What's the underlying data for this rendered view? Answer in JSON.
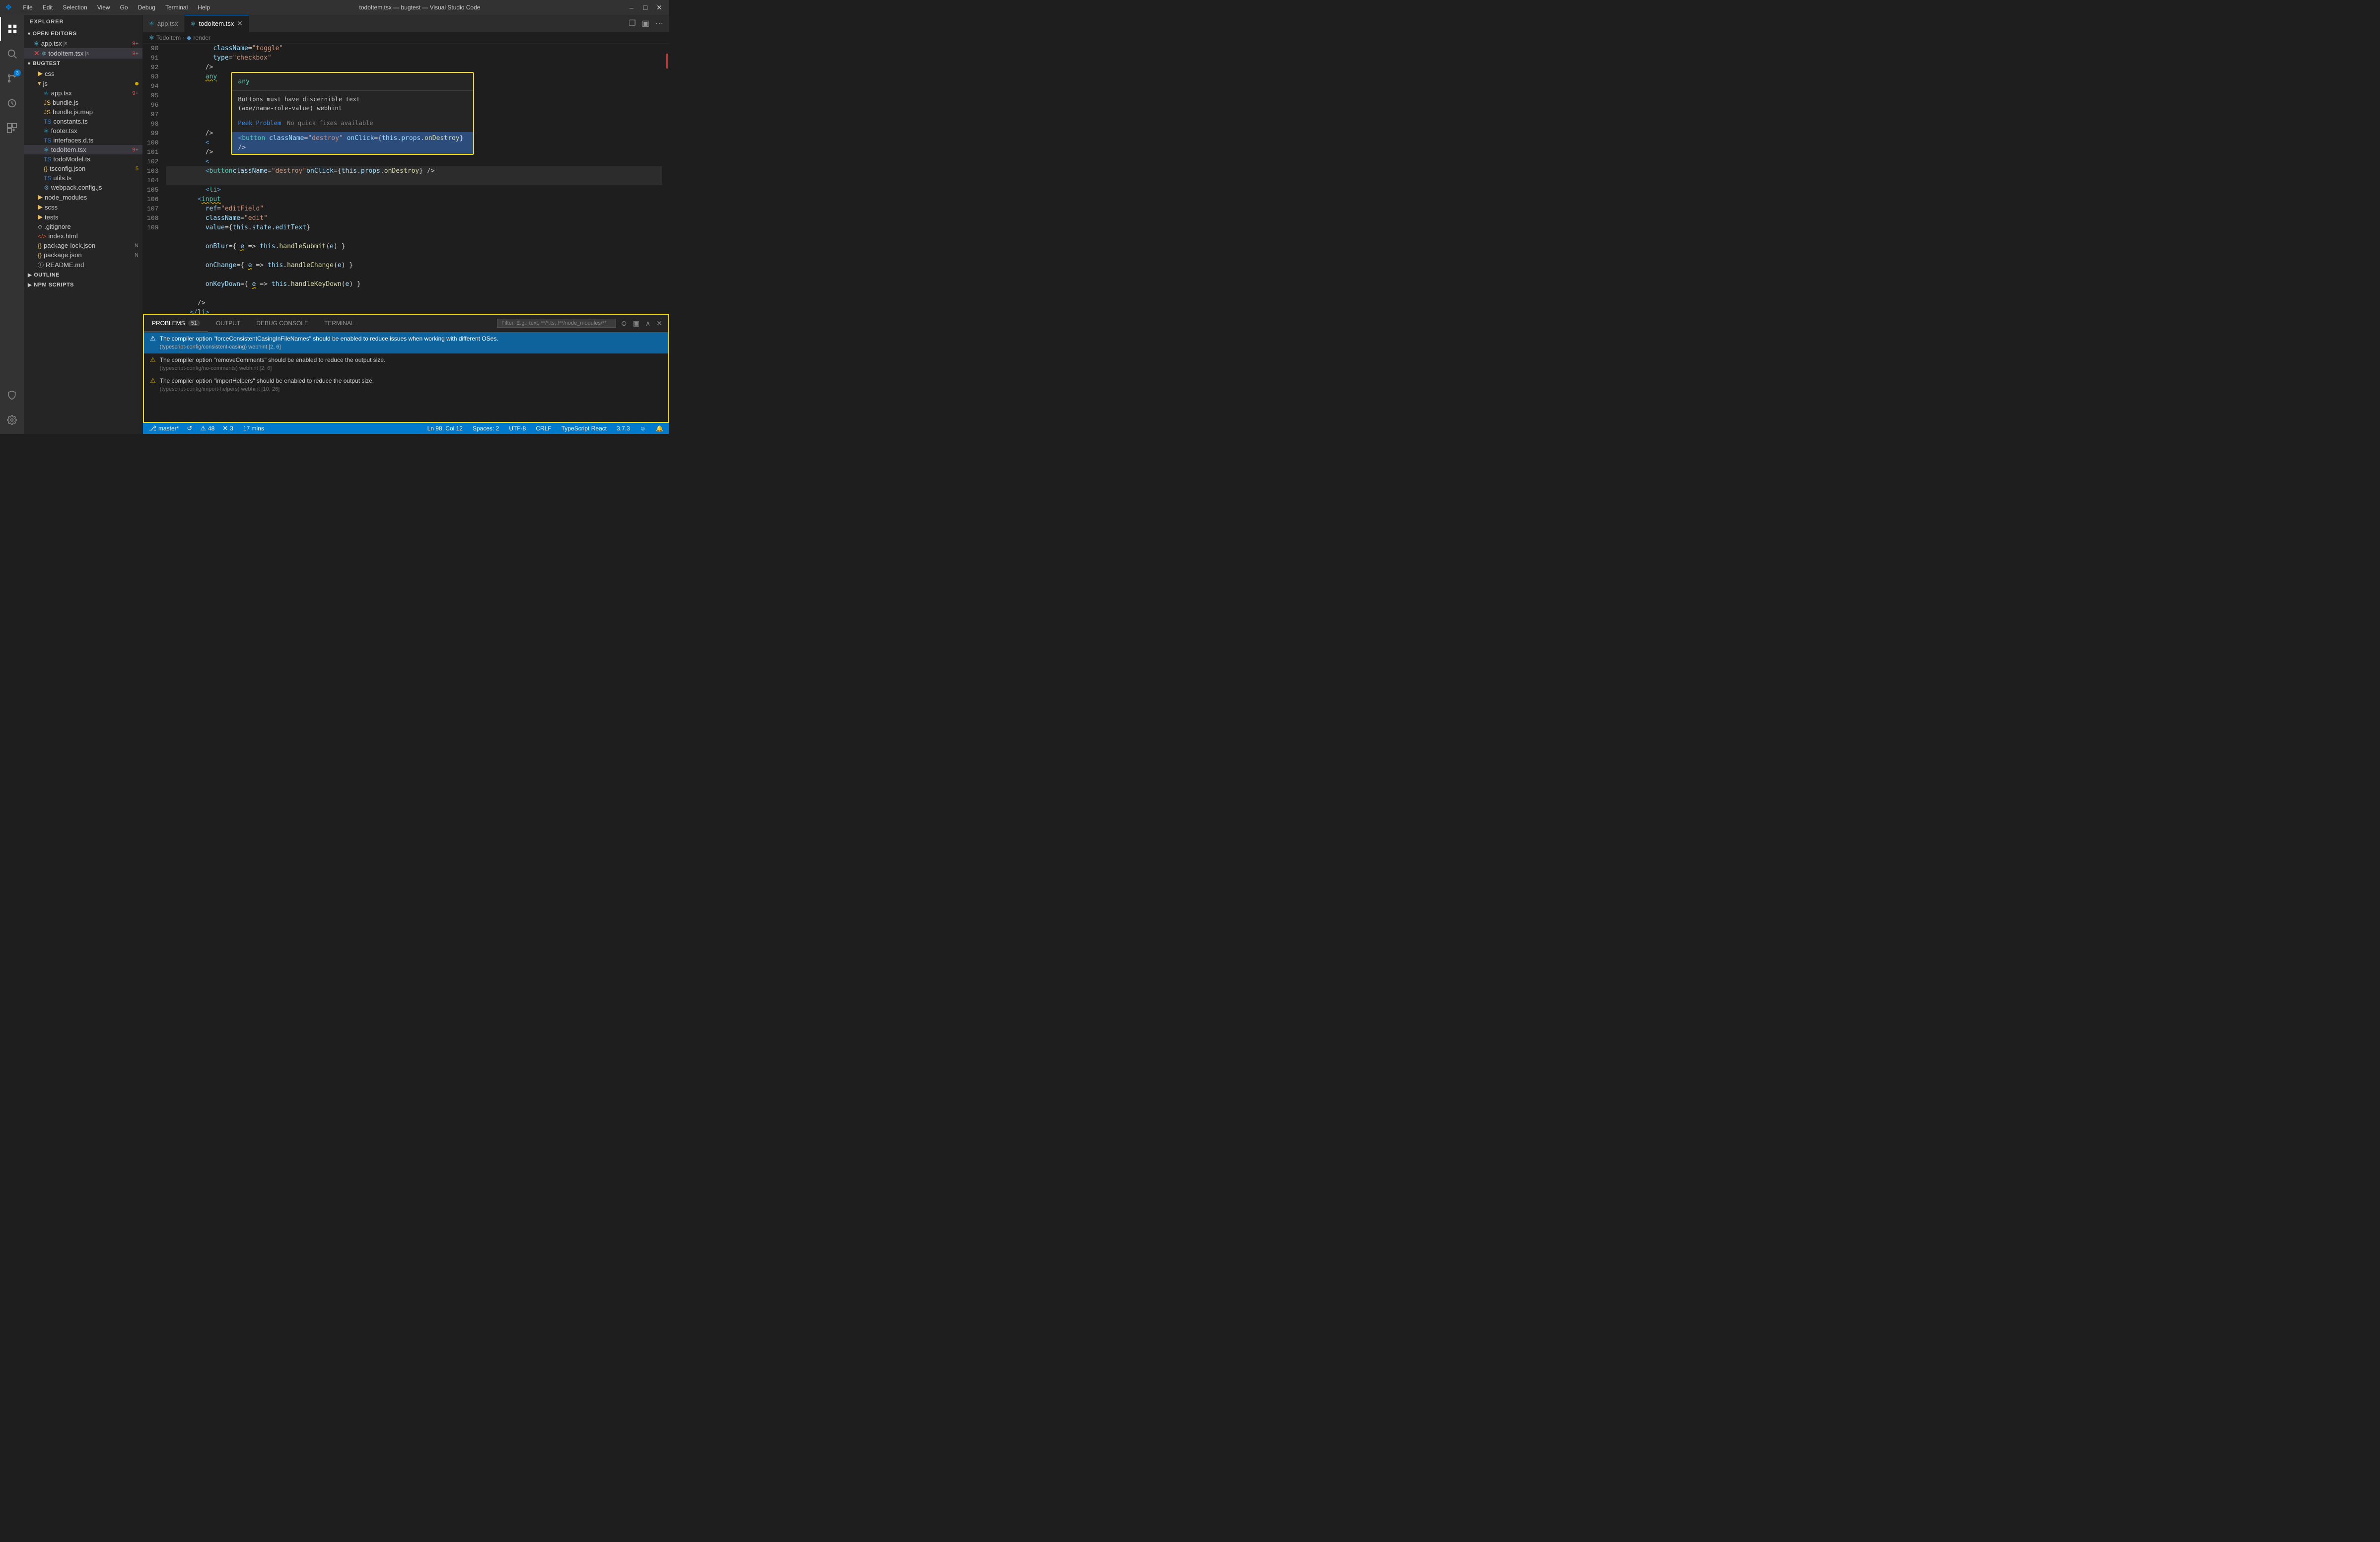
{
  "titlebar": {
    "title": "todoItem.tsx — bugtest — Visual Studio Code",
    "menu_items": [
      "File",
      "Edit",
      "Selection",
      "View",
      "Go",
      "Debug",
      "Terminal",
      "Help"
    ],
    "controls": [
      "─",
      "☐",
      "✕"
    ]
  },
  "activity_bar": {
    "icons": [
      {
        "name": "explorer-icon",
        "symbol": "⎘",
        "active": true
      },
      {
        "name": "search-icon",
        "symbol": "🔍"
      },
      {
        "name": "source-control-icon",
        "symbol": "⎇",
        "badge": "3"
      },
      {
        "name": "debug-icon",
        "symbol": "🐛"
      },
      {
        "name": "extensions-icon",
        "symbol": "⊞"
      }
    ],
    "bottom_icons": [
      {
        "name": "remote-icon",
        "symbol": "⚙"
      },
      {
        "name": "settings-icon",
        "symbol": "⚙"
      }
    ]
  },
  "sidebar": {
    "title": "EXPLORER",
    "sections": {
      "open_editors": {
        "label": "OPEN EDITORS",
        "items": [
          {
            "name": "app.tsx",
            "lang": "js",
            "badge": "9+",
            "badge_type": "error"
          },
          {
            "name": "todoItem.tsx",
            "lang": "js",
            "badge": "9+",
            "badge_type": "error",
            "active": true
          }
        ]
      },
      "bugtest": {
        "label": "BUGTEST",
        "items": [
          {
            "name": "css",
            "type": "folder"
          },
          {
            "name": "js",
            "type": "folder",
            "has_dot": true
          },
          {
            "name": "app.tsx",
            "type": "file",
            "lang": "react",
            "badge": "9+"
          },
          {
            "name": "bundle.js",
            "type": "file",
            "lang": "js"
          },
          {
            "name": "bundle.js.map",
            "type": "file",
            "lang": "js"
          },
          {
            "name": "constants.ts",
            "type": "file",
            "lang": "ts"
          },
          {
            "name": "footer.tsx",
            "type": "file",
            "lang": "react"
          },
          {
            "name": "interfaces.d.ts",
            "type": "file",
            "lang": "ts"
          },
          {
            "name": "todoItem.tsx",
            "type": "file",
            "lang": "react",
            "badge": "9+",
            "active": true
          },
          {
            "name": "todoModel.ts",
            "type": "file",
            "lang": "ts"
          },
          {
            "name": "tsconfig.json",
            "type": "file",
            "lang": "json",
            "badge": "5"
          },
          {
            "name": "utils.ts",
            "type": "file",
            "lang": "ts"
          },
          {
            "name": "webpack.config.js",
            "type": "file",
            "lang": "js"
          },
          {
            "name": "node_modules",
            "type": "folder"
          },
          {
            "name": "scss",
            "type": "folder"
          },
          {
            "name": "tests",
            "type": "folder"
          },
          {
            "name": ".gitignore",
            "type": "file"
          },
          {
            "name": "index.html",
            "type": "file"
          },
          {
            "name": "package-lock.json",
            "type": "file",
            "badge": "N"
          },
          {
            "name": "package.json",
            "type": "file",
            "badge": "N"
          },
          {
            "name": "README.md",
            "type": "file"
          }
        ]
      },
      "outline": {
        "label": "OUTLINE"
      },
      "npm_scripts": {
        "label": "NPM SCRIPTS"
      }
    }
  },
  "tabs": [
    {
      "label": "app.tsx",
      "lang": "react",
      "active": false
    },
    {
      "label": "todoItem.tsx",
      "lang": "react",
      "active": true,
      "closeable": true
    }
  ],
  "breadcrumb": {
    "items": [
      "TodoItem",
      "render"
    ]
  },
  "editor": {
    "lines": [
      {
        "num": 90,
        "content": "            className=\"toggle\""
      },
      {
        "num": 91,
        "content": "            type=\"checkbox\""
      },
      {
        "num": 92,
        "content": "          />"
      },
      {
        "num": 93,
        "content": "          any",
        "popup": true
      },
      {
        "num": 94,
        "content": "          />"
      },
      {
        "num": 95,
        "content": "          <"
      },
      {
        "num": 96,
        "content": "          />"
      },
      {
        "num": 97,
        "content": "          <"
      },
      {
        "num": 98,
        "content": "          <button className=\"destroy\" onClick={this.props.onDestroy} />",
        "highlighted": true
      },
      {
        "num": 99,
        "content": "          <li>"
      },
      {
        "num": 100,
        "content": "        <input"
      },
      {
        "num": 101,
        "content": "          ref=\"editField\""
      },
      {
        "num": 102,
        "content": "          className=\"edit\""
      },
      {
        "num": 103,
        "content": "          value={this.state.editText}"
      },
      {
        "num": 104,
        "content": "          onBlur={ e => this.handleSubmit(e) }"
      },
      {
        "num": 105,
        "content": "          onChange={ e => this.handleChange(e) }"
      },
      {
        "num": 106,
        "content": "          onKeyDown={ e => this.handleKeyDown(e) }"
      },
      {
        "num": 107,
        "content": "        />"
      },
      {
        "num": 108,
        "content": "      </li>"
      },
      {
        "num": 109,
        "content": "    );"
      }
    ],
    "popup": {
      "type_text": "any",
      "message_line1": "Buttons must have discernible text",
      "message_line2": "(axe/name-role-value)  webhint",
      "peek_label": "Peek Problem",
      "no_fix_label": "No quick fixes available"
    }
  },
  "problems_panel": {
    "tabs": [
      {
        "label": "PROBLEMS",
        "count": "51",
        "active": true
      },
      {
        "label": "OUTPUT",
        "active": false
      },
      {
        "label": "DEBUG CONSOLE",
        "active": false
      },
      {
        "label": "TERMINAL",
        "active": false
      }
    ],
    "filter_placeholder": "Filter. E.g.: text, **/*.ts, !**/node_modules/**",
    "problems": [
      {
        "type": "warning",
        "message": "The compiler option \"forceConsistentCasingInFileNames\" should be enabled to reduce issues when working with different OSes.",
        "source": "(typescript-config/consistent-casing)  webhint  [2, 6]",
        "selected": true
      },
      {
        "type": "warning",
        "message": "The compiler option \"removeComments\" should be enabled to reduce the output size.",
        "source": "(typescript-config/no-comments)  webhint  [2, 6]",
        "selected": false
      },
      {
        "type": "warning",
        "message": "The compiler option \"importHelpers\" should be enabled to reduce the output size.",
        "source": "(typescript-config/import-helpers)  webhint  [10, 26]",
        "selected": false
      }
    ]
  },
  "status_bar": {
    "left": [
      {
        "icon": "⎇",
        "text": "master*"
      },
      {
        "icon": "↺",
        "text": ""
      },
      {
        "icon": "⚠",
        "text": "48"
      },
      {
        "icon": "✕",
        "text": "3"
      }
    ],
    "center": "17 mins",
    "right": [
      {
        "text": "Ln 98, Col 12"
      },
      {
        "text": "Spaces: 2"
      },
      {
        "text": "UTF-8"
      },
      {
        "text": "CRLF"
      },
      {
        "text": "TypeScript React"
      },
      {
        "text": "3.7.3"
      },
      {
        "icon": "☺"
      },
      {
        "icon": "🔔"
      }
    ]
  }
}
